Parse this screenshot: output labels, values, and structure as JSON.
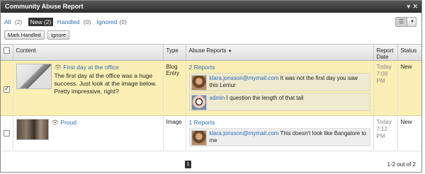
{
  "panel": {
    "title": "Community Abuse Report"
  },
  "filters": {
    "all": {
      "label": "All",
      "count": "(2)"
    },
    "new": {
      "label": "New (2)"
    },
    "handled": {
      "label": "Handled",
      "count": "(0)"
    },
    "ignored": {
      "label": "Ignored",
      "count": "(0)"
    }
  },
  "actions": {
    "mark_handled": "Mark Handled",
    "ignore": "Ignore"
  },
  "columns": {
    "content": "Content",
    "type": "Type",
    "abuse_reports": "Abuse Reports",
    "report_date": "Report Date",
    "status": "Status"
  },
  "rows": [
    {
      "title": "First day at the office",
      "description": "The first day at the office was a huge success. Just look at the image below. Pretty impressive, right?",
      "type": "Blog Entry",
      "reports_link": "2 Reports",
      "reports": [
        {
          "author": "klara.jonsson@mymail.com",
          "text": "It was not the first day you saw this Lemur"
        },
        {
          "author": "admin",
          "text": "I question the length of that tail"
        }
      ],
      "date": "Today 7:08 PM",
      "status": "New",
      "checked": true
    },
    {
      "title": "Proud",
      "description": "",
      "type": "Image",
      "reports_link": "1 Reports",
      "reports": [
        {
          "author": "klara.jonsson@mymail.com",
          "text": "This doesn't look like Bangalore to me"
        }
      ],
      "date": "Today 7:12 PM",
      "status": "New",
      "checked": false
    }
  ],
  "pagination": {
    "current_page": "1",
    "summary": "1-2 out of 2"
  }
}
